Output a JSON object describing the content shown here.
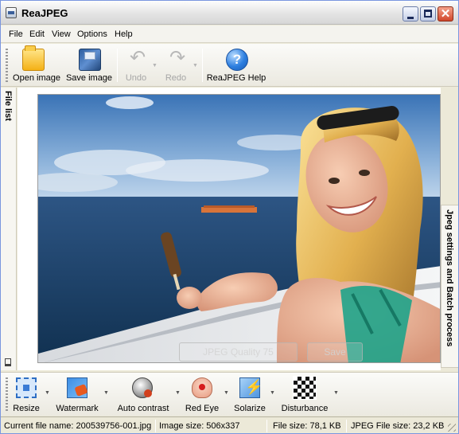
{
  "window": {
    "title": "ReaJPEG",
    "controls": [
      "minimize",
      "maximize",
      "close"
    ]
  },
  "menu": {
    "items": [
      "File",
      "Edit",
      "View",
      "Options",
      "Help"
    ]
  },
  "toolbar": {
    "open_label": "Open image",
    "save_label": "Save image",
    "undo_label": "Undo",
    "redo_label": "Redo",
    "help_label": "ReaJPEG Help"
  },
  "side_tabs": {
    "left": "File list",
    "right": "Jpeg settings and Batch process"
  },
  "image_overlay": {
    "quality_label": "JPEG Quality 75",
    "save_label": "Save"
  },
  "effects": {
    "resize": "Resize",
    "watermark": "Watermark",
    "auto_contrast": "Auto contrast",
    "red_eye": "Red Eye",
    "solarize": "Solarize",
    "disturbance": "Disturbance"
  },
  "status": {
    "current_file": "Current file name:  200539756-001.jpg",
    "image_size": "Image size:  506x337",
    "file_size": "File size:  78,1 KB",
    "jpeg_file_size": "JPEG File size:  23,2 KB"
  },
  "colors": {
    "window_frame": "#ece9d8",
    "accent": "#2d7fe0",
    "sky": "#5f94c9",
    "sea": "#1d3f6a"
  },
  "icons": {
    "open": "folder-icon",
    "save": "save-image-icon",
    "undo": "undo-icon",
    "redo": "redo-icon",
    "help": "help-icon"
  }
}
